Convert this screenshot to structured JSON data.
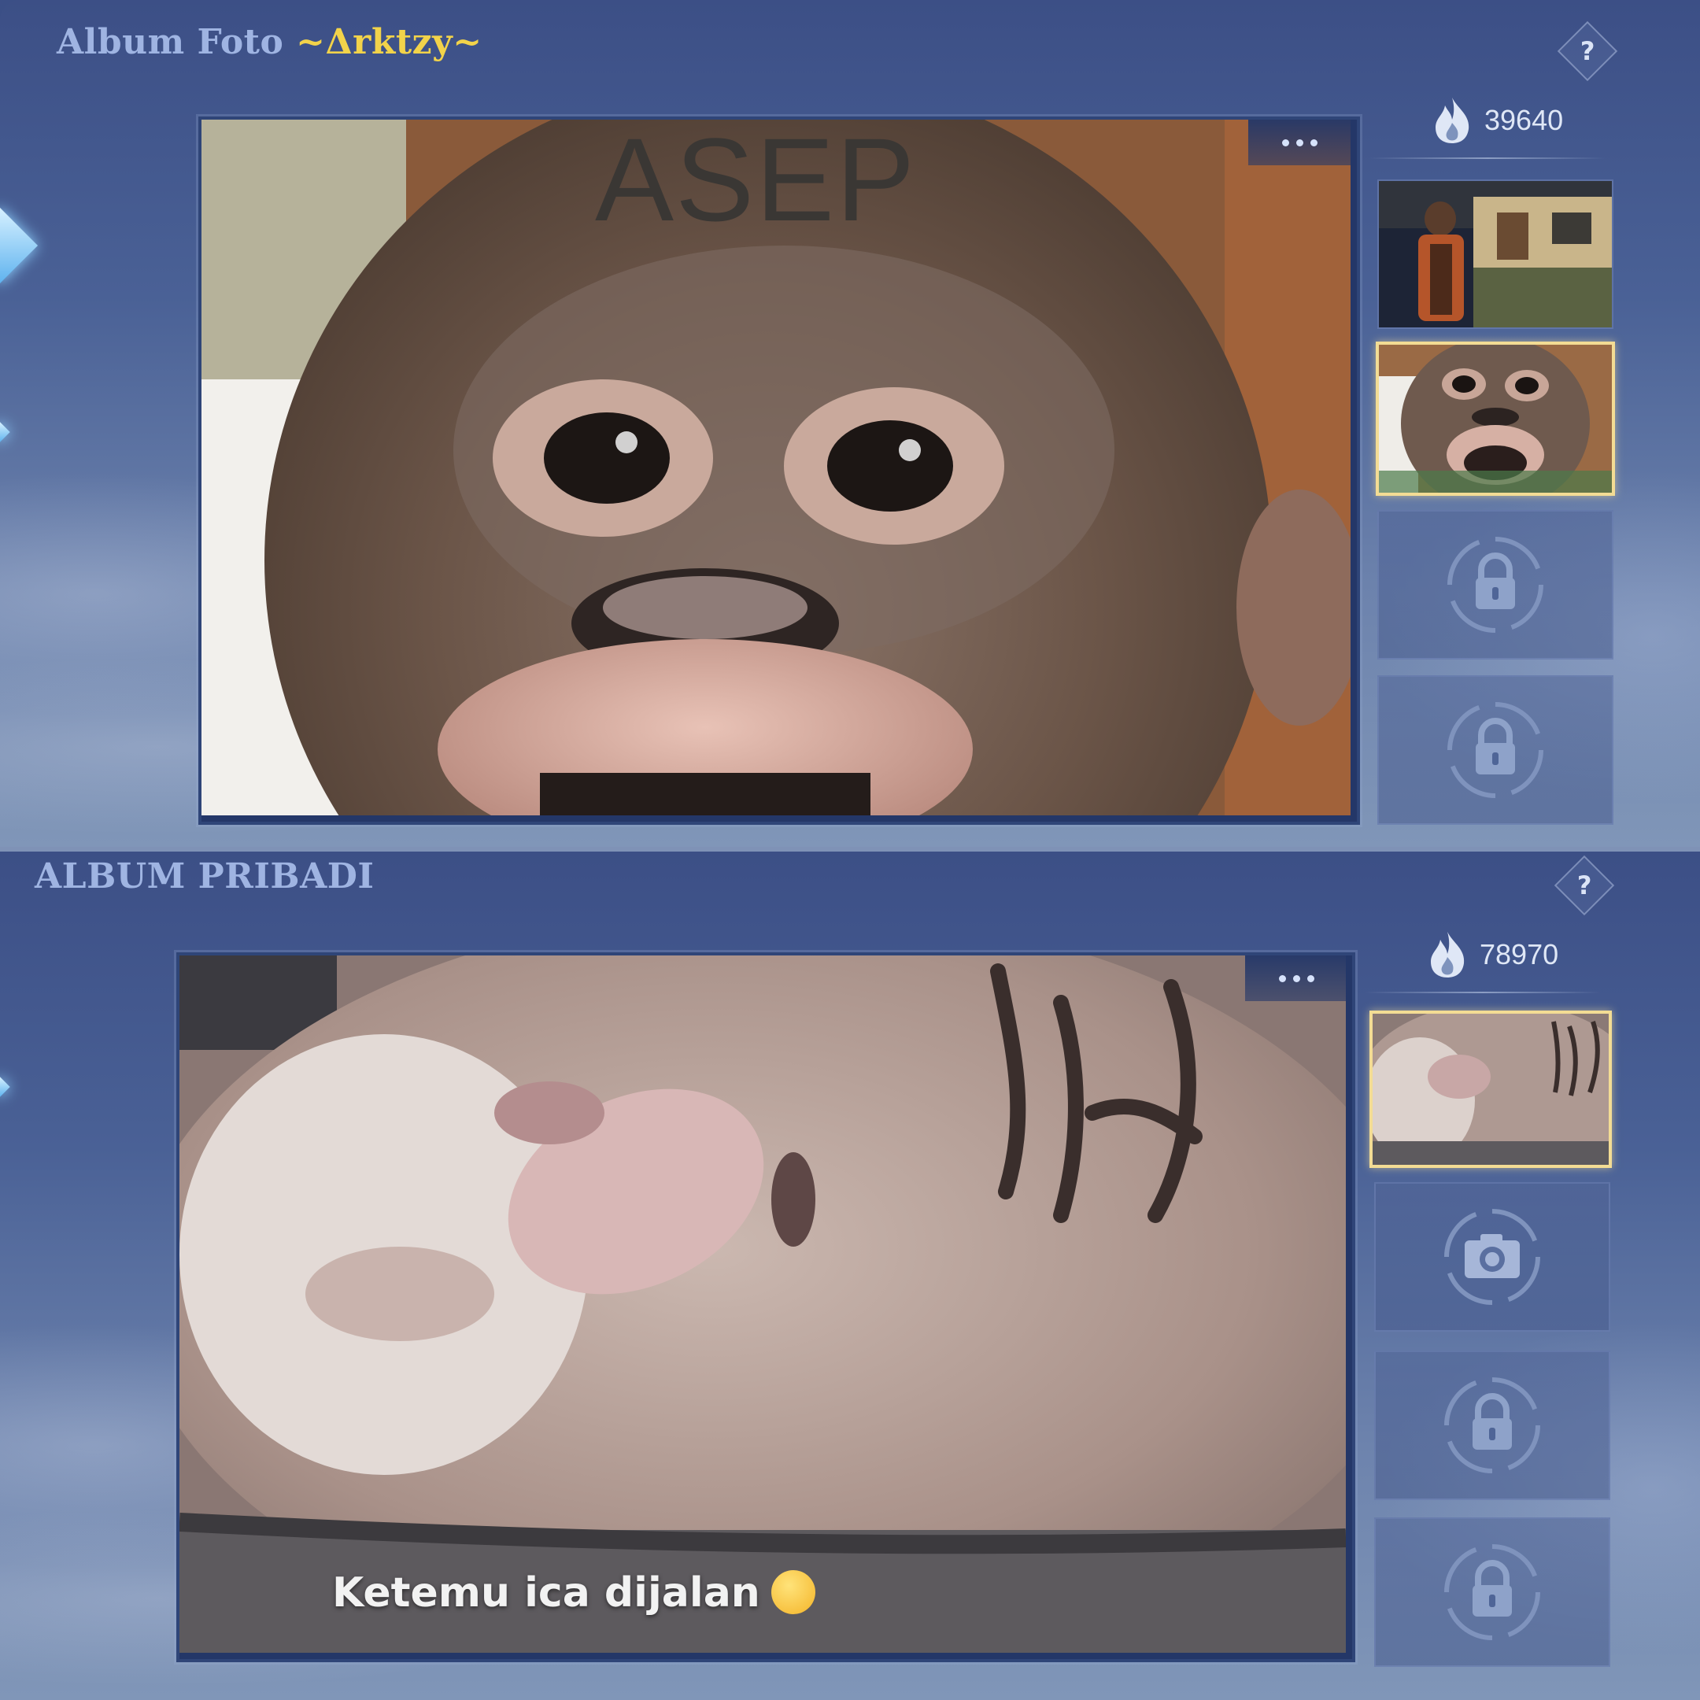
{
  "panels": [
    {
      "title_label": "Album Foto",
      "owner_name": "~Δrktzy~",
      "help_label": "?",
      "popularity": "39640",
      "photo_caption": "ASEP",
      "thumbnails": [
        "photo",
        "photo-selected",
        "locked",
        "locked"
      ]
    },
    {
      "title_label": "ALBUM PRIBADI",
      "help_label": "?",
      "popularity": "78970",
      "photo_caption": "Ketemu ica dijalan",
      "thumbnails": [
        "photo-selected",
        "camera-upload",
        "locked",
        "locked"
      ]
    }
  ],
  "colors": {
    "owner_name": "#f2d34a",
    "title": "#9fb4e2",
    "selected_border": "#f3dc94"
  },
  "icons": [
    "fire-icon",
    "lock-icon",
    "camera-icon",
    "more-dots-icon",
    "help-icon"
  ]
}
